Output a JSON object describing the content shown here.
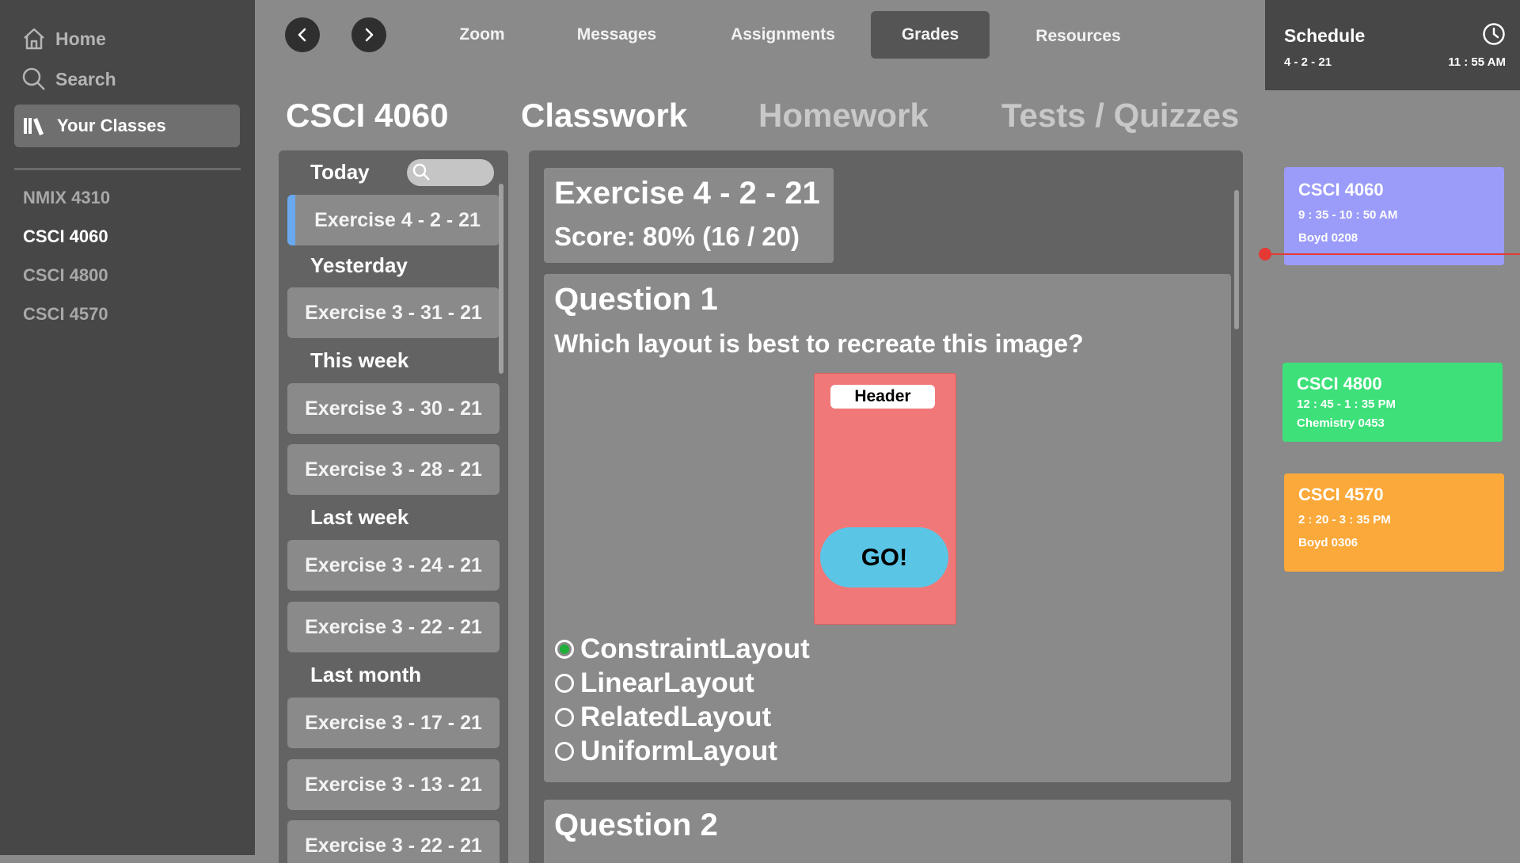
{
  "sidebar": {
    "home_label": "Home",
    "search_label": "Search",
    "your_classes_label": "Your Classes",
    "classes": [
      {
        "label": "NMIX 4310",
        "active": false
      },
      {
        "label": "CSCI 4060",
        "active": true
      },
      {
        "label": "CSCI 4800",
        "active": false
      },
      {
        "label": "CSCI 4570",
        "active": false
      }
    ]
  },
  "topnav": {
    "tabs": [
      {
        "label": "Zoom",
        "active": false
      },
      {
        "label": "Messages",
        "active": false
      },
      {
        "label": "Assignments",
        "active": false
      },
      {
        "label": "Grades",
        "active": true
      },
      {
        "label": "Resources",
        "active": false
      }
    ]
  },
  "header": {
    "course": "CSCI 4060",
    "tabs": [
      {
        "label": "Classwork",
        "active": true
      },
      {
        "label": "Homework",
        "active": false
      },
      {
        "label": "Tests / Quizzes",
        "active": false
      }
    ]
  },
  "list": {
    "groups": [
      {
        "label": "Today",
        "items": [
          "Exercise 4 - 2 - 21"
        ]
      },
      {
        "label": "Yesterday",
        "items": [
          "Exercise 3 - 31 - 21"
        ]
      },
      {
        "label": "This week",
        "items": [
          "Exercise 3 - 30 - 21",
          "Exercise 3 - 28 - 21"
        ]
      },
      {
        "label": "Last week",
        "items": [
          "Exercise 3 - 24 - 21",
          "Exercise 3 - 22 - 21"
        ]
      },
      {
        "label": "Last month",
        "items": [
          "Exercise 3 - 17 - 21",
          "Exercise 3 - 13 - 21",
          "Exercise 3 - 22 - 21"
        ]
      }
    ]
  },
  "detail": {
    "title": "Exercise 4 - 2 - 21",
    "score": "Score: 80% (16 / 20)",
    "q1": {
      "title": "Question 1",
      "text": "Which layout is best to recreate this image?",
      "mock_header": "Header",
      "mock_button": "GO!",
      "options": [
        "ConstraintLayout",
        "LinearLayout",
        "RelatedLayout",
        "UniformLayout"
      ],
      "selected": 0
    },
    "q2": {
      "title": "Question 2"
    }
  },
  "schedule": {
    "title": "Schedule",
    "date": "4 - 2 - 21",
    "time": "11 : 55 AM",
    "classes": [
      {
        "name": "CSCI 4060",
        "time": "9 : 35 - 10 : 50 AM",
        "room": "Boyd 0208",
        "color": "#9b9cf9"
      },
      {
        "name": "CSCI 4800",
        "time": "12 : 45 - 1 : 35 PM",
        "room": "Chemistry 0453",
        "color": "#3ee07a"
      },
      {
        "name": "CSCI 4570",
        "time": "2 : 20 - 3 : 35 PM",
        "room": "Boyd 0306",
        "color": "#fba93a"
      }
    ]
  },
  "colors": {
    "sidebar_bg": "#474747",
    "main_bg": "#8a8a8a",
    "panel_bg": "#636363",
    "active_accent": "#6aa8f0",
    "now_line": "#e53935",
    "selected_radio": "#1fae3a"
  }
}
